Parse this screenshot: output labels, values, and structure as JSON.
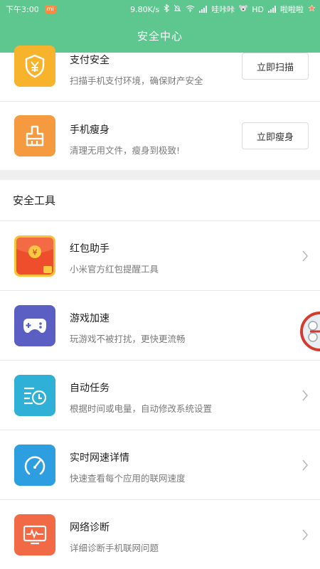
{
  "status": {
    "time": "下午3:00",
    "mi": "mi",
    "speed": "9.80K/s",
    "carrier1": "哇咔咔",
    "hd": "HD",
    "carrier2": "啦啦啦"
  },
  "header": {
    "title": "安全中心"
  },
  "top_items": [
    {
      "title": "支付安全",
      "desc": "扫描手机支付环境，确保财产安全",
      "button": "立即扫描",
      "icon": "shield-yen-icon",
      "color": "#f7b32b"
    },
    {
      "title": "手机瘦身",
      "desc": "清理无用文件，瘦身到极致!",
      "button": "立即瘦身",
      "icon": "broom-icon",
      "color": "#f59a3e"
    }
  ],
  "section": {
    "title": "安全工具"
  },
  "tools": [
    {
      "title": "红包助手",
      "desc": "小米官方红包提醒工具",
      "icon": "red-envelope-icon",
      "color": "#f4572f"
    },
    {
      "title": "游戏加速",
      "desc": "玩游戏不被打扰，更快更流畅",
      "icon": "gamepad-icon",
      "color": "#5b5fc4"
    },
    {
      "title": "自动任务",
      "desc": "根据时间或电量，自动修改系统设置",
      "icon": "clock-list-icon",
      "color": "#2fb0d6"
    },
    {
      "title": "实时网速详情",
      "desc": "快速查看每个应用的联网速度",
      "icon": "speedometer-icon",
      "color": "#2d9ee0"
    },
    {
      "title": "网络诊断",
      "desc": "详细诊断手机联网问题",
      "icon": "network-monitor-icon",
      "color": "#f26a45"
    }
  ]
}
